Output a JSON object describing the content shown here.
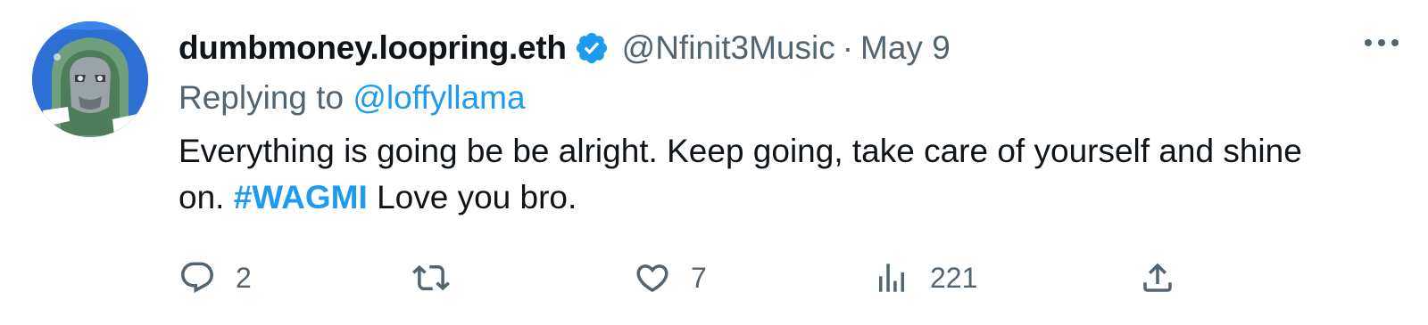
{
  "tweet": {
    "display_name": "dumbmoney.loopring.eth",
    "handle": "@Nfinit3Music",
    "separator": "·",
    "date": "May 9",
    "replying_prefix": "Replying to",
    "replying_to": "@loffyllama",
    "text_part1": "Everything is going be be alright. Keep going, take care of yourself and shine on.",
    "hashtag": "#WAGMI",
    "text_part2": "Love you bro.",
    "verified": true
  },
  "actions": {
    "reply_count": "2",
    "retweet_count": "",
    "like_count": "7",
    "views_count": "221"
  },
  "icons": {
    "verified": "verified-badge-icon",
    "more": "more-options-icon",
    "reply": "reply-icon",
    "retweet": "retweet-icon",
    "like": "like-icon",
    "views": "views-icon",
    "share": "share-icon"
  },
  "colors": {
    "accent": "#1d9bf0",
    "secondary_text": "#536471",
    "primary_text": "#0f1419"
  }
}
